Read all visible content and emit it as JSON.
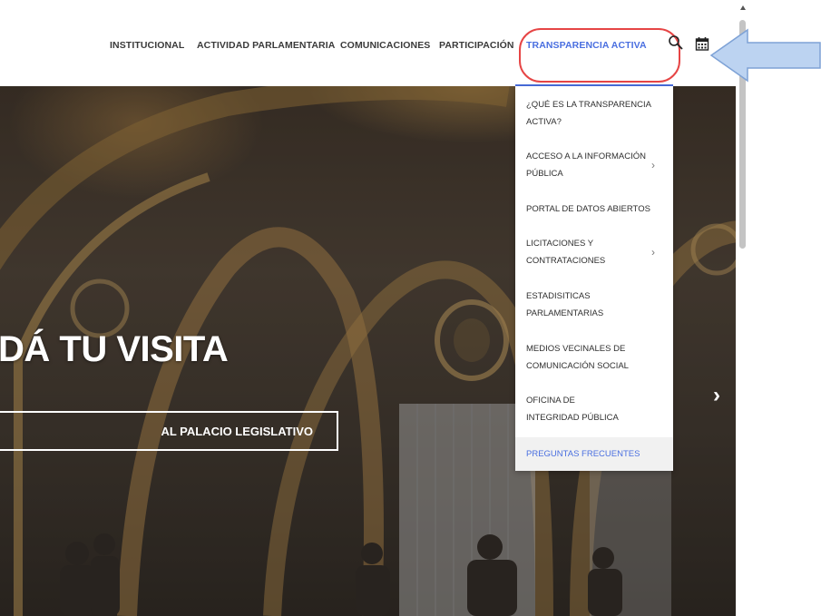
{
  "nav": {
    "items": [
      {
        "label": "INSTITUCIONAL"
      },
      {
        "label": "ACTIVIDAD PARLAMENTARIA"
      },
      {
        "label": "COMUNICACIONES"
      },
      {
        "label": "PARTICIPACIÓN"
      },
      {
        "label": "TRANSPARENCIA ACTIVA"
      }
    ],
    "icons": [
      "search-icon",
      "calendar-icon"
    ]
  },
  "dropdown": {
    "items": [
      {
        "lines": [
          "¿QUÉ ES LA TRANSPARENCIA",
          "ACTIVA?"
        ],
        "has_submenu": false
      },
      {
        "lines": [
          "ACCESO A LA INFORMACIÓN",
          "PÚBLICA"
        ],
        "has_submenu": true
      },
      {
        "lines": [
          "PORTAL DE DATOS ABIERTOS"
        ],
        "has_submenu": false
      },
      {
        "lines": [
          "LICITACIONES Y",
          "CONTRATACIONES"
        ],
        "has_submenu": true
      },
      {
        "lines": [
          "ESTADISITICAS",
          "PARLAMENTARIAS"
        ],
        "has_submenu": false
      },
      {
        "lines": [
          "MEDIOS VECINALES DE",
          "COMUNICACIÓN SOCIAL"
        ],
        "has_submenu": false
      },
      {
        "lines": [
          "OFICINA DE",
          "INTEGRIDAD PÚBLICA"
        ],
        "has_submenu": false
      },
      {
        "lines": [
          "PREGUNTAS FRECUENTES"
        ],
        "has_submenu": false
      }
    ],
    "chevron": "›"
  },
  "hero": {
    "headline": "DÁ TU VISITA",
    "button_label": "AL PALACIO LEGISLATIVO",
    "next_arrow": "›"
  },
  "colors": {
    "accent": "#4a6fe0",
    "highlight": "#e64545",
    "callout_fill": "#bcd3f1",
    "callout_stroke": "#7ea2d6"
  }
}
